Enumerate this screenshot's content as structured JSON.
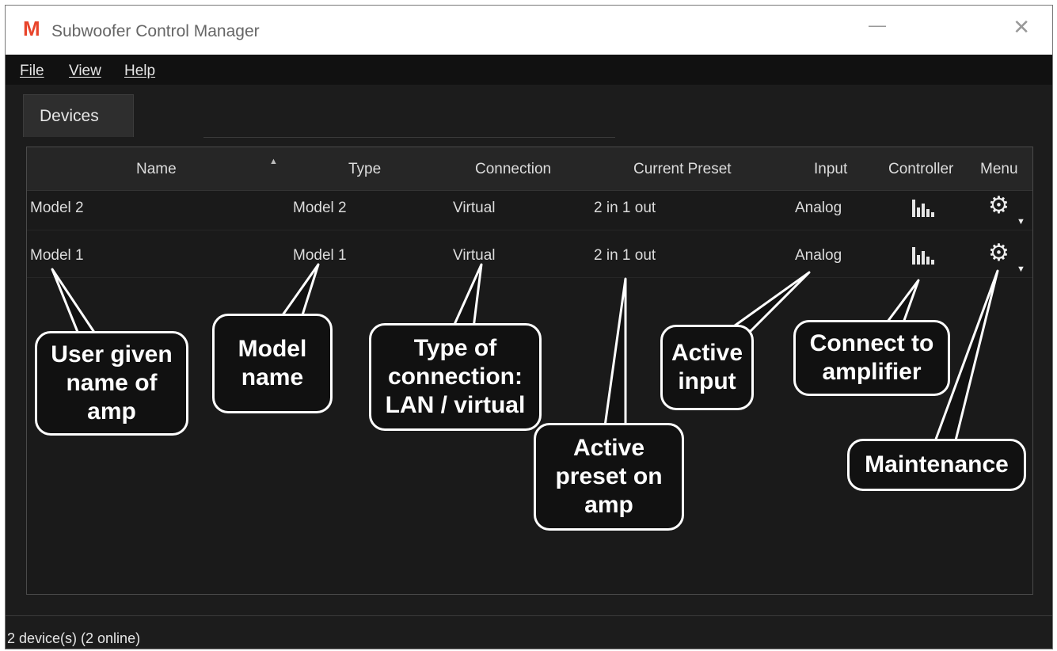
{
  "window": {
    "logo_letter": "M",
    "title": "Subwoofer Control Manager",
    "minimize_glyph": "—",
    "close_glyph": "✕"
  },
  "menu": [
    "File",
    "View",
    "Help"
  ],
  "tabs": [
    {
      "label": "Devices",
      "active": true
    }
  ],
  "table": {
    "columns": [
      "Name",
      "Type",
      "Connection",
      "Current Preset",
      "Input",
      "Controller",
      "Menu"
    ],
    "sort_glyph": "▲",
    "rows": [
      {
        "name": "Model 2",
        "type": "Model 2",
        "connection": "Virtual",
        "preset": "2 in 1 out",
        "input": "Analog",
        "controller_icon": "bar-chart-icon",
        "menu_icon": "gear-icon",
        "menu_caret": "▼"
      },
      {
        "name": "Model 1",
        "type": "Model 1",
        "connection": "Virtual",
        "preset": "2 in 1 out",
        "input": "Analog",
        "controller_icon": "bar-chart-icon",
        "menu_icon": "gear-icon",
        "menu_caret": "▼"
      }
    ]
  },
  "status": "2 device(s) (2 online)",
  "callouts": [
    "User given\nname of\namp",
    "Model\nname",
    "Type of\nconnection:\nLAN / virtual",
    "Active\npreset on\namp",
    "Active\ninput",
    "Connect to\namplifier",
    "Maintenance"
  ],
  "colors": {
    "accent": "#e8442b",
    "background": "#1c1c1c",
    "text": "#dcdcdc"
  }
}
